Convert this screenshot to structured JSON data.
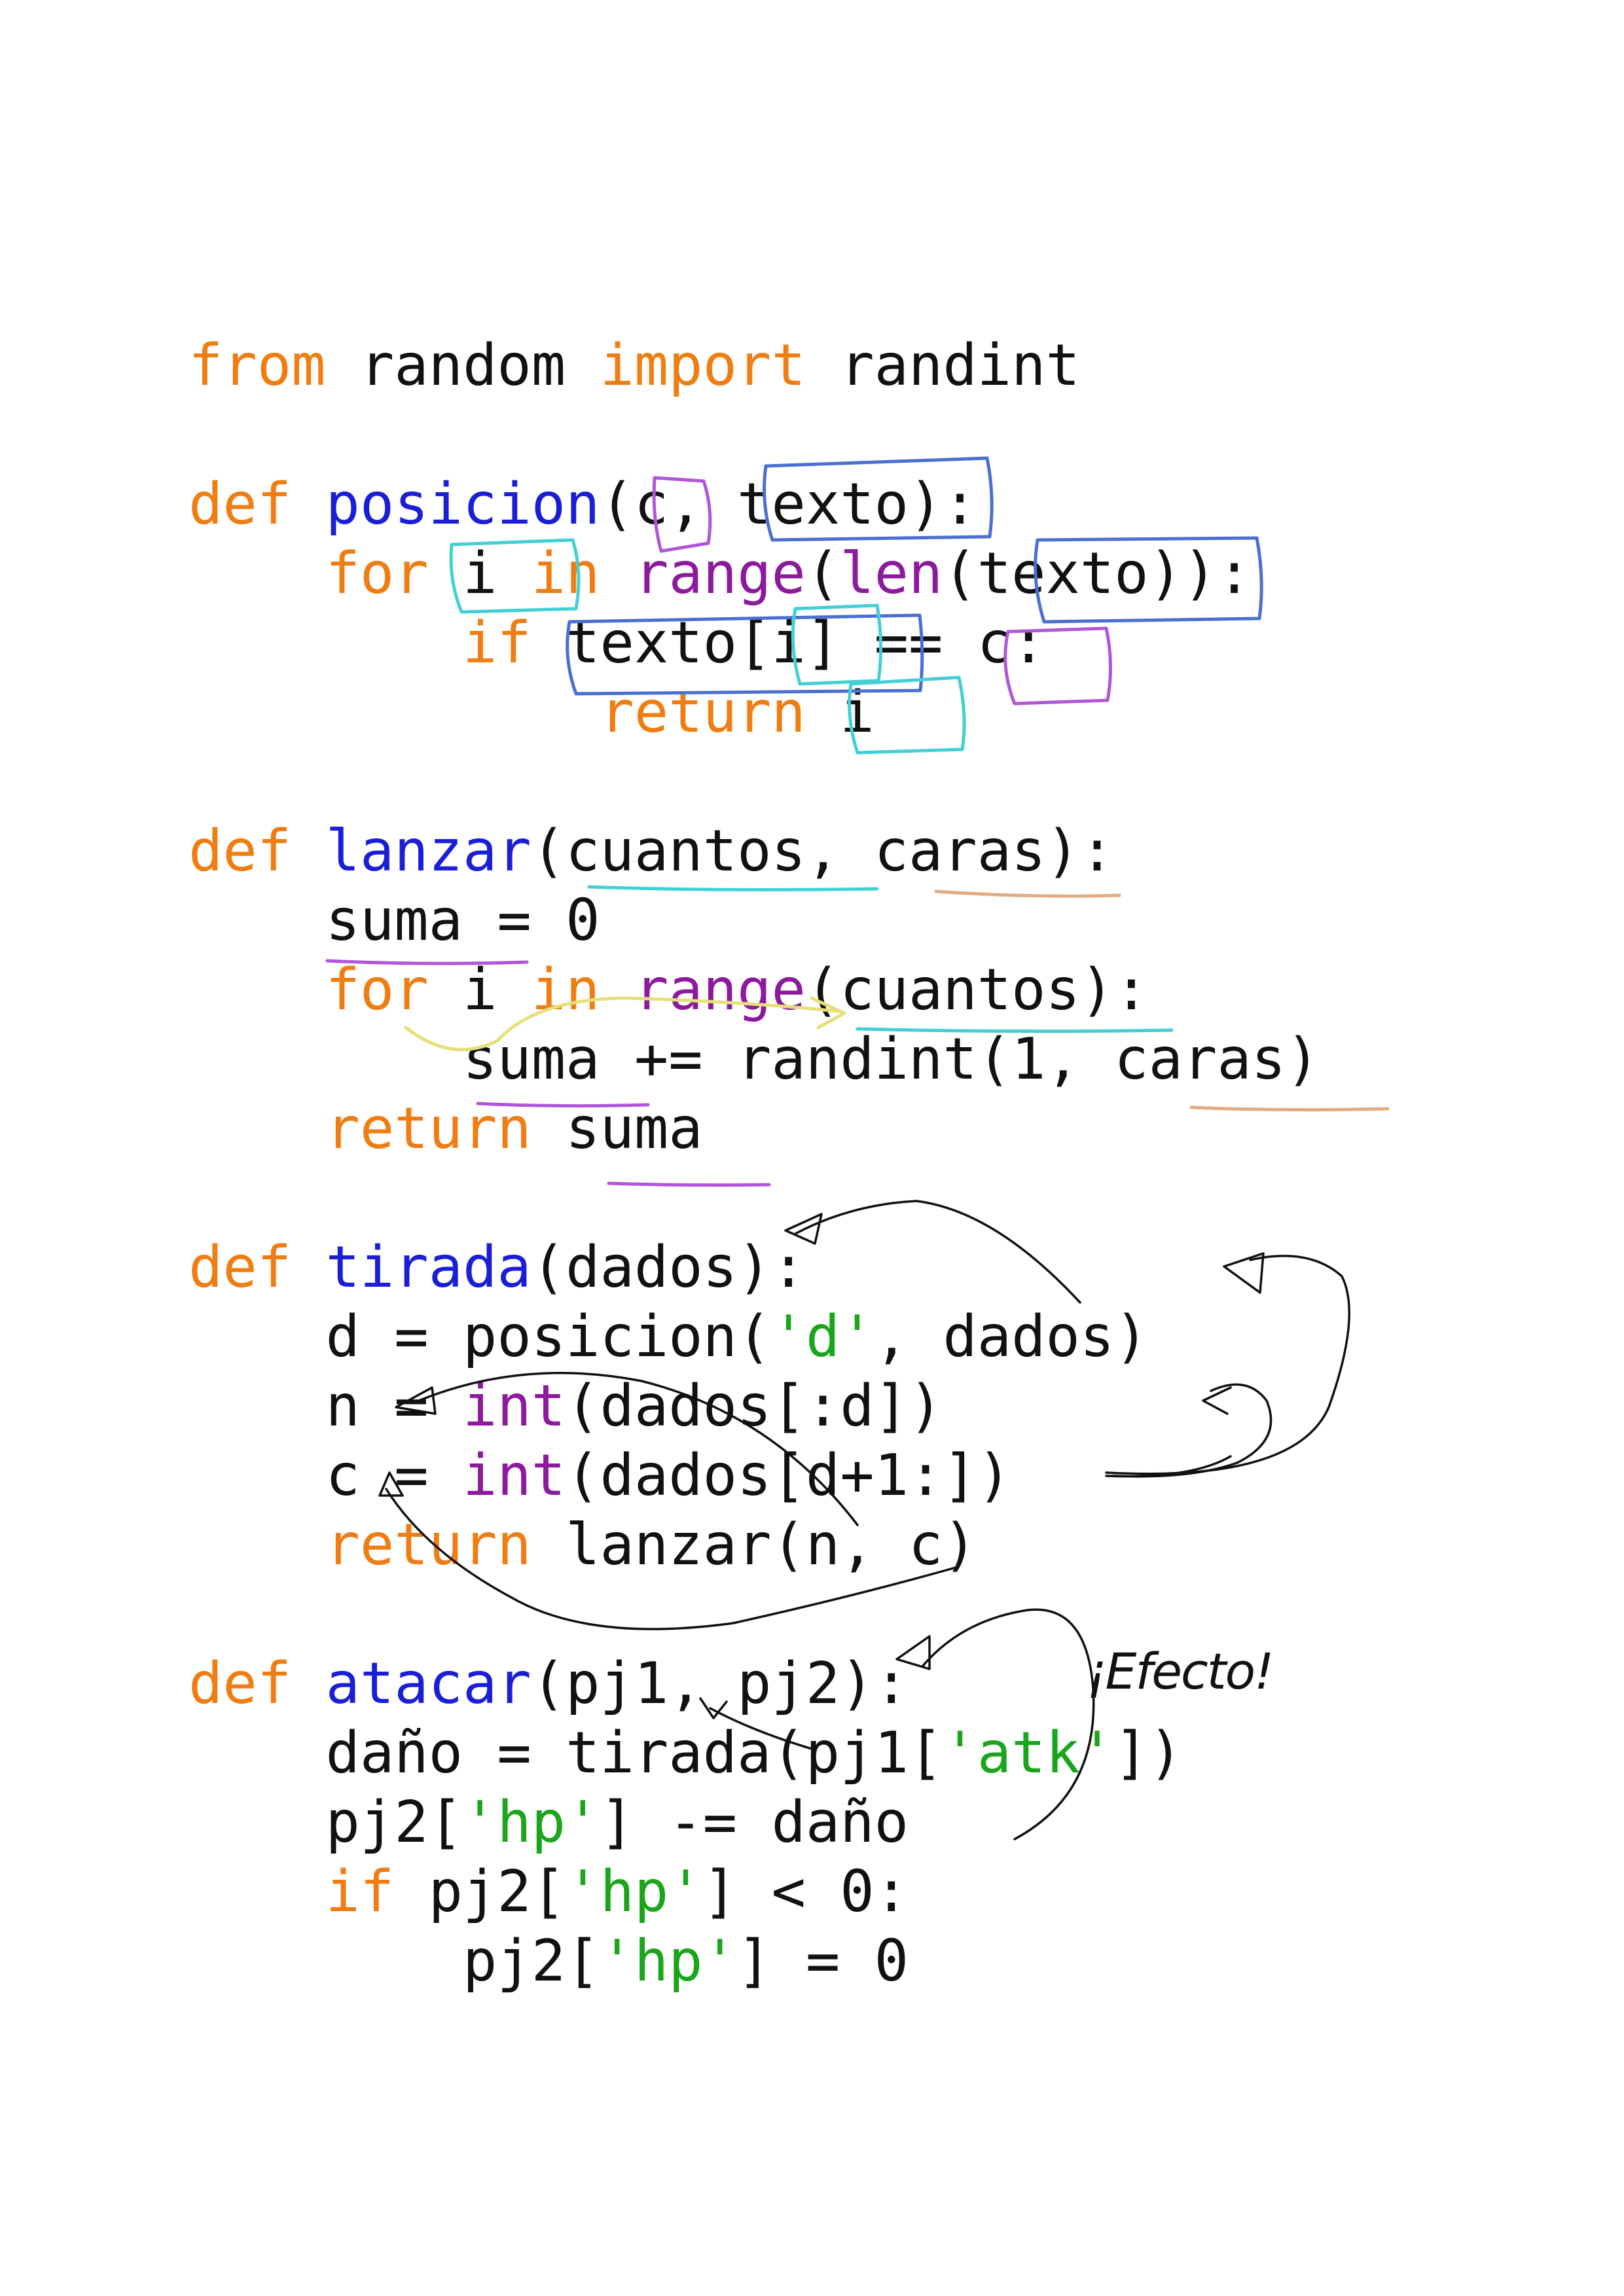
{
  "code_lines": [
    [
      {
        "t": "from",
        "c": "kw"
      },
      {
        "t": " random ",
        "c": "txt"
      },
      {
        "t": "import",
        "c": "kw"
      },
      {
        "t": " randint",
        "c": "txt"
      }
    ],
    [],
    [
      {
        "t": "def ",
        "c": "kw"
      },
      {
        "t": "posicion",
        "c": "fn"
      },
      {
        "t": "(c, texto):",
        "c": "txt"
      }
    ],
    [
      {
        "t": "    ",
        "c": "txt"
      },
      {
        "t": "for",
        "c": "kw"
      },
      {
        "t": " i ",
        "c": "txt"
      },
      {
        "t": "in",
        "c": "kw"
      },
      {
        "t": " ",
        "c": "txt"
      },
      {
        "t": "range",
        "c": "builtin"
      },
      {
        "t": "(",
        "c": "txt"
      },
      {
        "t": "len",
        "c": "builtin"
      },
      {
        "t": "(texto)):",
        "c": "txt"
      }
    ],
    [
      {
        "t": "        ",
        "c": "txt"
      },
      {
        "t": "if",
        "c": "kw"
      },
      {
        "t": " texto[i] == c:",
        "c": "txt"
      }
    ],
    [
      {
        "t": "            ",
        "c": "txt"
      },
      {
        "t": "return",
        "c": "kw"
      },
      {
        "t": " i",
        "c": "txt"
      }
    ],
    [],
    [
      {
        "t": "def ",
        "c": "kw"
      },
      {
        "t": "lanzar",
        "c": "fn"
      },
      {
        "t": "(cuantos, caras):",
        "c": "txt"
      }
    ],
    [
      {
        "t": "    suma = 0",
        "c": "txt"
      }
    ],
    [
      {
        "t": "    ",
        "c": "txt"
      },
      {
        "t": "for",
        "c": "kw"
      },
      {
        "t": " i ",
        "c": "txt"
      },
      {
        "t": "in",
        "c": "kw"
      },
      {
        "t": " ",
        "c": "txt"
      },
      {
        "t": "range",
        "c": "builtin"
      },
      {
        "t": "(cuantos):",
        "c": "txt"
      }
    ],
    [
      {
        "t": "        suma += randint(1, caras)",
        "c": "txt"
      }
    ],
    [
      {
        "t": "    ",
        "c": "txt"
      },
      {
        "t": "return",
        "c": "kw"
      },
      {
        "t": " suma",
        "c": "txt"
      }
    ],
    [],
    [
      {
        "t": "def ",
        "c": "kw"
      },
      {
        "t": "tirada",
        "c": "fn"
      },
      {
        "t": "(dados):",
        "c": "txt"
      }
    ],
    [
      {
        "t": "    d = posicion(",
        "c": "txt"
      },
      {
        "t": "'d'",
        "c": "str"
      },
      {
        "t": ", dados)",
        "c": "txt"
      }
    ],
    [
      {
        "t": "    n = ",
        "c": "txt"
      },
      {
        "t": "int",
        "c": "builtin"
      },
      {
        "t": "(dados[:d])",
        "c": "txt"
      }
    ],
    [
      {
        "t": "    c = ",
        "c": "txt"
      },
      {
        "t": "int",
        "c": "builtin"
      },
      {
        "t": "(dados[d+1:])",
        "c": "txt"
      }
    ],
    [
      {
        "t": "    ",
        "c": "txt"
      },
      {
        "t": "return",
        "c": "kw"
      },
      {
        "t": " lanzar(n, c)",
        "c": "txt"
      }
    ],
    [],
    [
      {
        "t": "def ",
        "c": "kw"
      },
      {
        "t": "atacar",
        "c": "fn"
      },
      {
        "t": "(pj1, pj2):",
        "c": "txt"
      }
    ],
    [
      {
        "t": "    daño = tirada(pj1[",
        "c": "txt"
      },
      {
        "t": "'atk'",
        "c": "str"
      },
      {
        "t": "])",
        "c": "txt"
      }
    ],
    [
      {
        "t": "    pj2[",
        "c": "txt"
      },
      {
        "t": "'hp'",
        "c": "str"
      },
      {
        "t": "] -= daño",
        "c": "txt"
      }
    ],
    [
      {
        "t": "    ",
        "c": "txt"
      },
      {
        "t": "if",
        "c": "kw"
      },
      {
        "t": " pj2[",
        "c": "txt"
      },
      {
        "t": "'hp'",
        "c": "str"
      },
      {
        "t": "] < 0:",
        "c": "txt"
      }
    ],
    [
      {
        "t": "        pj2[",
        "c": "txt"
      },
      {
        "t": "'hp'",
        "c": "str"
      },
      {
        "t": "] = 0",
        "c": "txt"
      }
    ]
  ],
  "handwritten_note": "¡Efecto!",
  "colors": {
    "keyword": "#ef7d12",
    "function_name": "#1a1fd6",
    "builtin": "#8c1a9c",
    "string": "#1aa51a",
    "text": "#111111",
    "ink_blue": "#4a6fd0",
    "ink_purple": "#b056d8",
    "ink_cyan": "#43cfd6",
    "ink_orange": "#e0ac84",
    "ink_yellow": "#e6e07a"
  }
}
